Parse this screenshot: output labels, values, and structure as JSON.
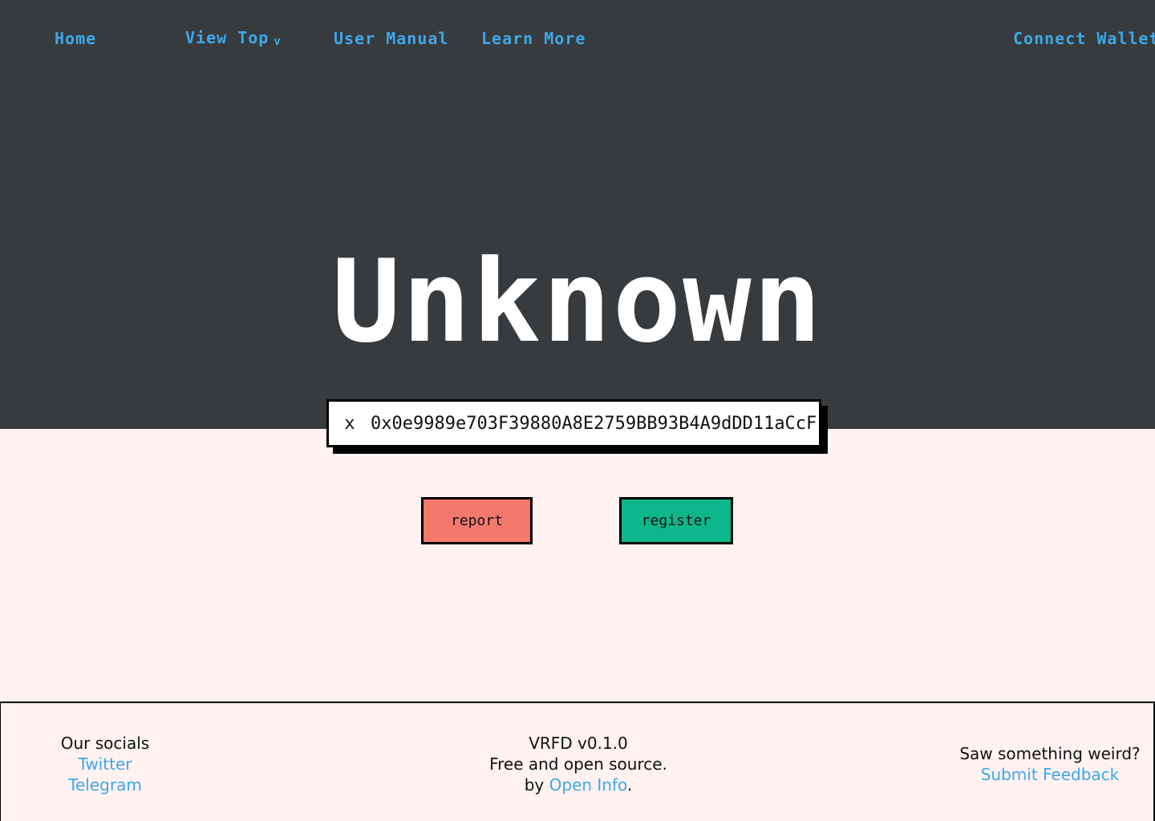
{
  "nav": {
    "home": "Home",
    "view_top": "View Top",
    "view_top_chevron": "v",
    "user_manual": "User Manual",
    "learn_more": "Learn More",
    "connect_wallet": "Connect Wallet"
  },
  "hero": {
    "title": "Unknown",
    "address_close": "x",
    "address": "0x0e9989e703F39880A8E2759BB93B4A9dDD11aCcF"
  },
  "actions": {
    "report": "report",
    "register": "register"
  },
  "footer": {
    "socials_heading": "Our socials",
    "twitter": "Twitter",
    "telegram": "Telegram",
    "version": "VRFD v0.1.0",
    "tagline": "Free and open source.",
    "by_prefix": "by ",
    "by_link": "Open Info",
    "by_suffix": ".",
    "weird_heading": "Saw something weird?",
    "feedback_link": "Submit Feedback"
  },
  "colors": {
    "hero_bg": "#373b3e",
    "page_bg": "#fff2f1",
    "link": "#3ea7e8",
    "report": "#f2796c",
    "register": "#0db78b"
  }
}
